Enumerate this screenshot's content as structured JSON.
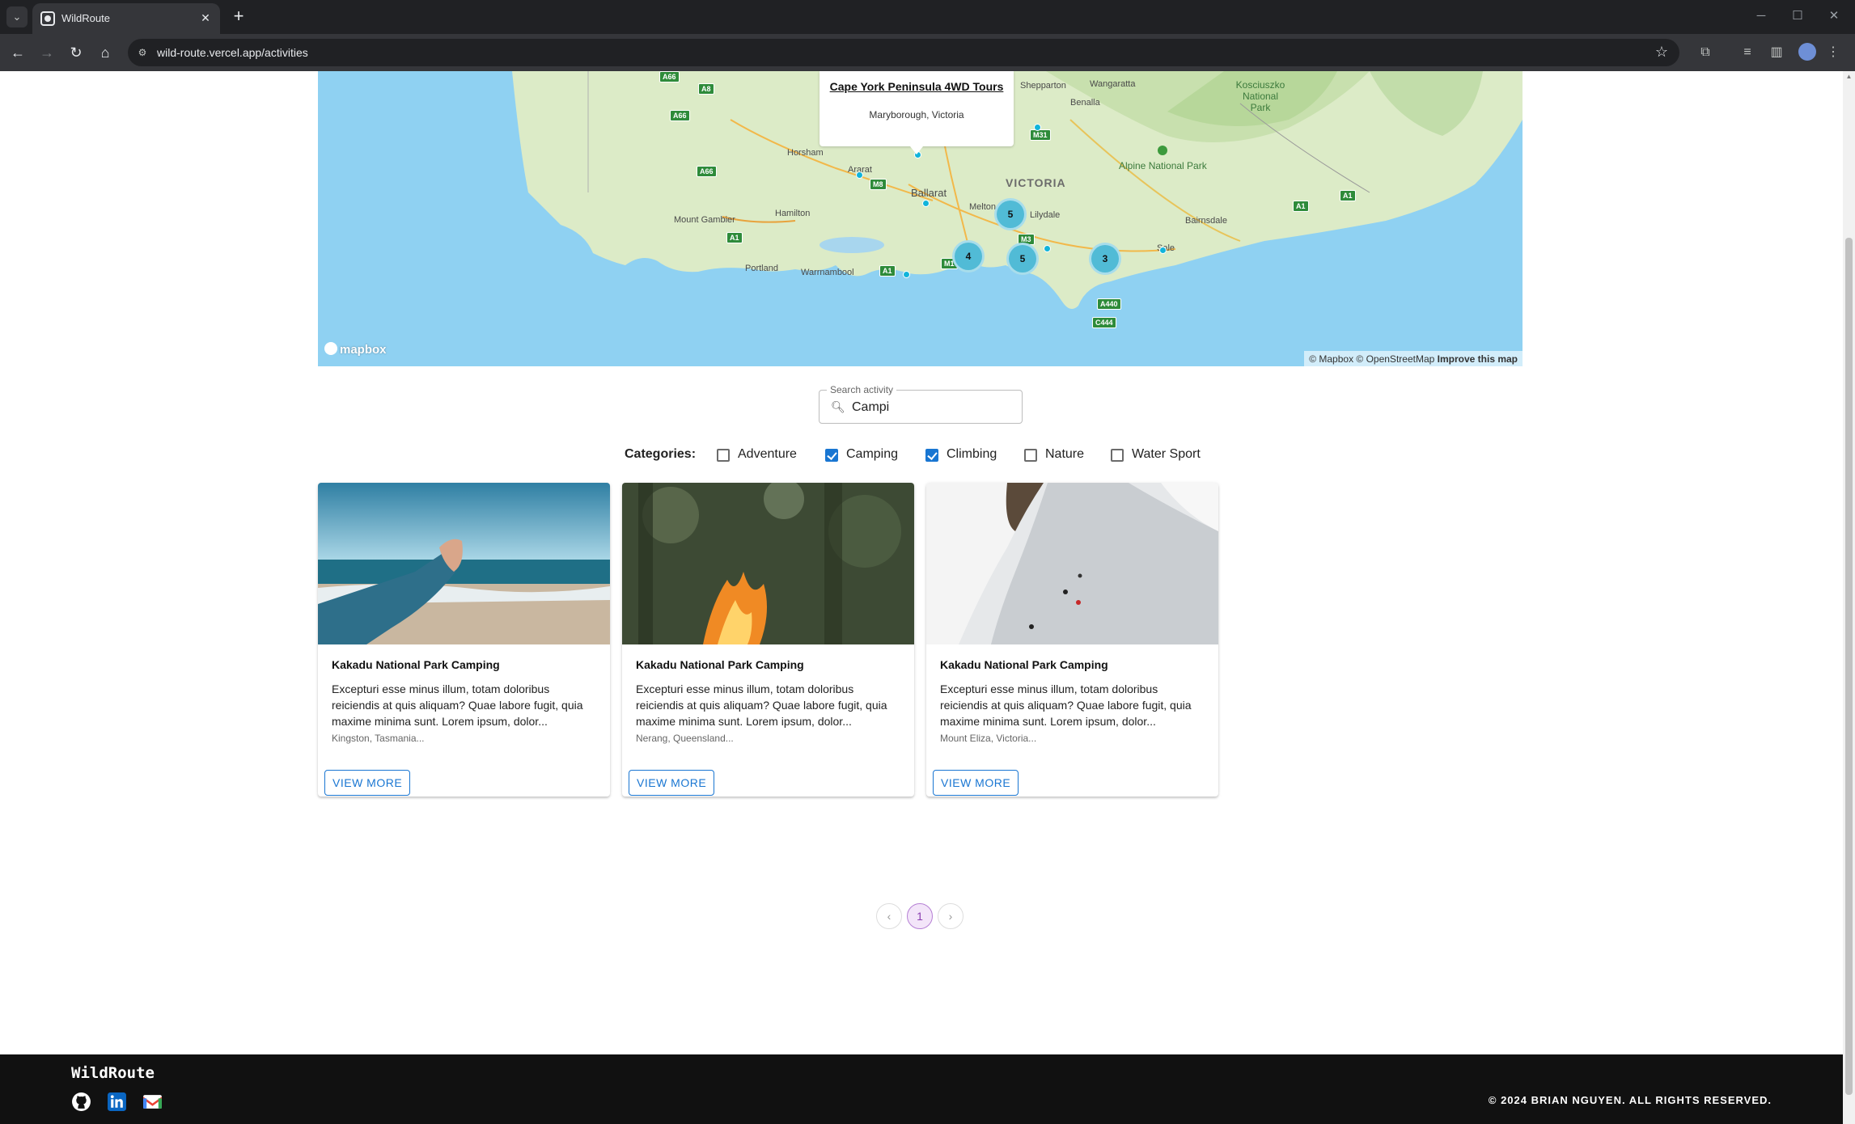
{
  "browser": {
    "tab_title": "WildRoute",
    "url": "wild-route.vercel.app/activities",
    "new_tab_label": "+",
    "close_tab_label": "✕"
  },
  "map": {
    "popup": {
      "title": "Cape York Peninsula 4WD Tours",
      "subtitle": "Maryborough, Victoria"
    },
    "state_label": "VICTORIA",
    "places": [
      "Horsham",
      "Shepparton",
      "Wangaratta",
      "Benalla",
      "Ararat",
      "Ballarat",
      "Melton",
      "Lilydale",
      "Hamilton",
      "Mount Gambier",
      "Portland",
      "Warrnambool",
      "Bairnsdale",
      "Sale"
    ],
    "parks": [
      "Alpine National Park",
      "Kosciuszko National Park"
    ],
    "road_shields": [
      "A66",
      "A8",
      "A66",
      "A66",
      "M8",
      "A1",
      "A1",
      "M1",
      "M31",
      "M3",
      "A440",
      "C444",
      "A1",
      "A1",
      "M3"
    ],
    "clusters": [
      "5",
      "4",
      "5",
      "3"
    ],
    "logo": "mapbox",
    "attribution": "© Mapbox © OpenStreetMap",
    "improve_link": "Improve this map"
  },
  "search": {
    "legend": "Search activity",
    "value": "Campi",
    "icon": "search-icon"
  },
  "categories": {
    "label": "Categories:",
    "items": [
      {
        "label": "Adventure",
        "checked": false
      },
      {
        "label": "Camping",
        "checked": true
      },
      {
        "label": "Climbing",
        "checked": true
      },
      {
        "label": "Nature",
        "checked": false
      },
      {
        "label": "Water Sport",
        "checked": false
      }
    ]
  },
  "cards": [
    {
      "title": "Kakadu National Park Camping",
      "description": "Excepturi esse minus illum, totam doloribus reiciendis at quis aliquam? Quae labore fugit, quia maxime minima sunt. Lorem ipsum, dolor...",
      "location": "Kingston, Tasmania...",
      "button": "VIEW MORE"
    },
    {
      "title": "Kakadu National Park Camping",
      "description": "Excepturi esse minus illum, totam doloribus reiciendis at quis aliquam? Quae labore fugit, quia maxime minima sunt. Lorem ipsum, dolor...",
      "location": "Nerang, Queensland...",
      "button": "VIEW MORE"
    },
    {
      "title": "Kakadu National Park Camping",
      "description": "Excepturi esse minus illum, totam doloribus reiciendis at quis aliquam? Quae labore fugit, quia maxime minima sunt. Lorem ipsum, dolor...",
      "location": "Mount Eliza, Victoria...",
      "button": "VIEW MORE"
    }
  ],
  "pagination": {
    "prev": "‹",
    "current": "1",
    "next": "›"
  },
  "footer": {
    "brand": "WildRoute",
    "copyright": "© 2024 BRIAN NGUYEN. ALL RIGHTS RESERVED.",
    "social": [
      "github-icon",
      "linkedin-icon",
      "gmail-icon"
    ]
  },
  "colors": {
    "accent": "#1976d2",
    "cluster": "#51bbd6",
    "footer_bg": "#111111",
    "page_current": "#8a3fb0"
  }
}
